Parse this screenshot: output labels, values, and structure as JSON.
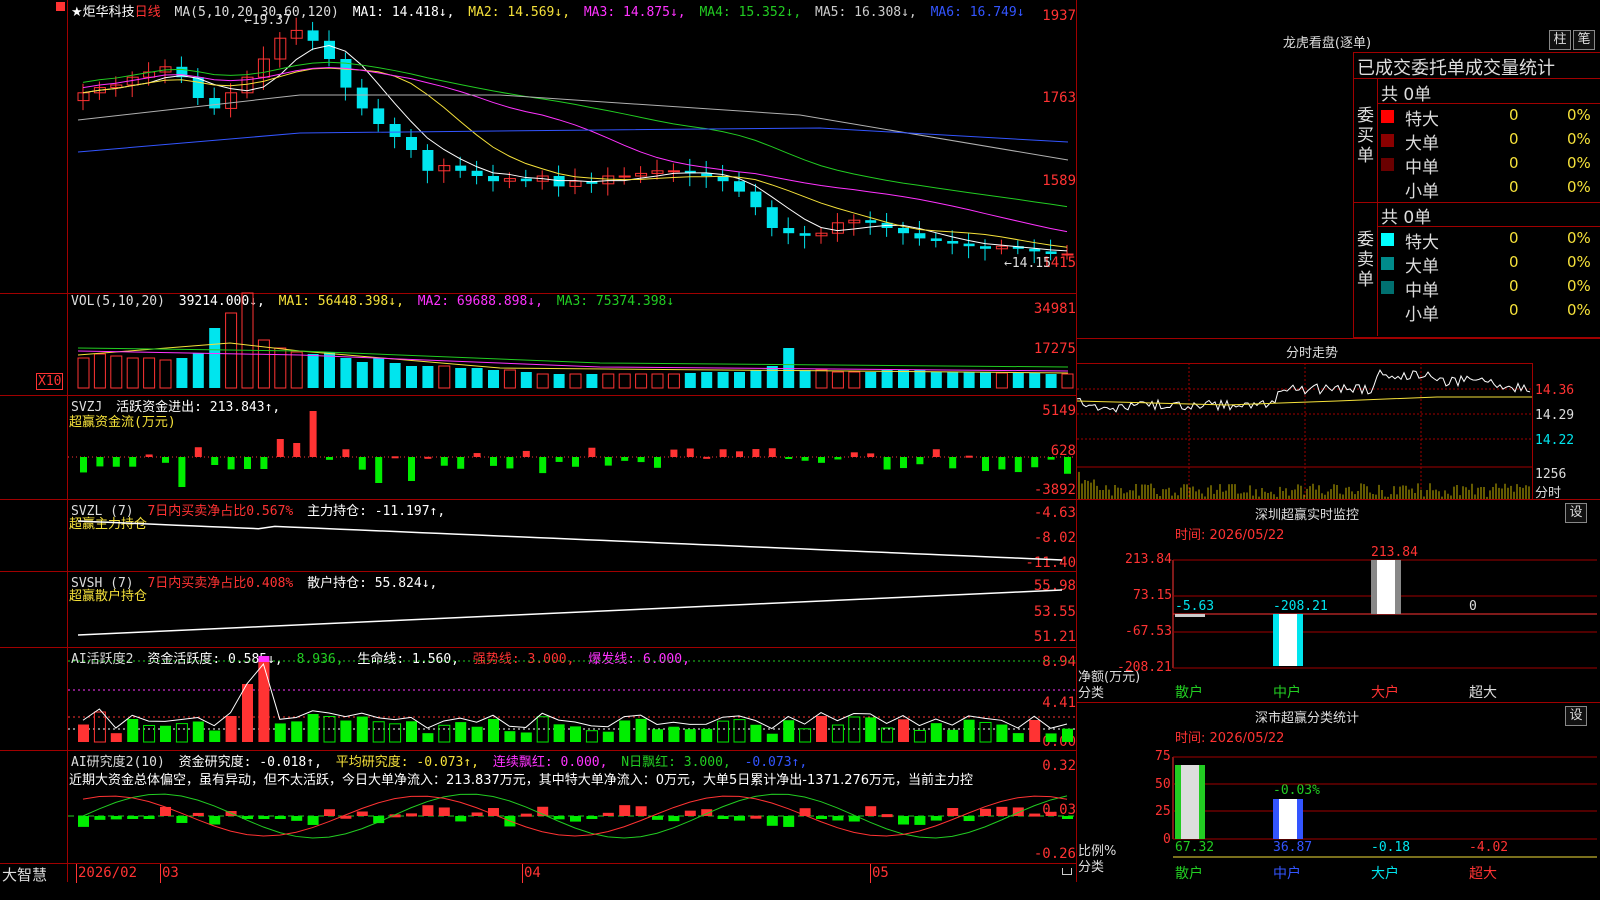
{
  "colors": {
    "up": "#ff3333",
    "down": "#00e5ee",
    "frame": "#a00000",
    "axis": "#ff3333",
    "ma1": "#ffffff",
    "ma2": "#f5e13a",
    "ma3": "#ff33ff",
    "ma4": "#22cc22",
    "ma5": "#b0b0b0",
    "ma6": "#3355ff"
  },
  "app": {
    "brand": "大智慧",
    "stock_name": "★炬华科技",
    "period": "日线"
  },
  "price": {
    "header": {
      "ma_def": "MA(5,10,20,30,60,120)",
      "ma1": "MA1: 14.418↓,",
      "ma2": "MA2: 14.569↓,",
      "ma3": "MA3: 14.875↓,",
      "ma4": "MA4: 15.352↓,",
      "ma5": "MA5: 16.308↓,",
      "ma6": "MA6: 16.749↓"
    },
    "yticks": [
      "1937",
      "1763",
      "1589",
      "1415"
    ],
    "high_label": "←19.37",
    "low_label": "←14.15"
  },
  "vol": {
    "header": {
      "def": "VOL(5,10,20)",
      "v": "39214.000↓,",
      "ma1": "MA1: 56448.398↓,",
      "ma2": "MA2: 69688.898↓,",
      "ma3": "MA3: 75374.398↓"
    },
    "yticks": [
      "34981",
      "17275"
    ],
    "unit": "X10"
  },
  "svzj": {
    "header": {
      "name": "SVZJ",
      "t1": "活跃资金进出: 213.843↑,",
      "sub": "超赢资金流(万元)"
    },
    "yticks": [
      "5149",
      "628",
      "-3892"
    ]
  },
  "svzl": {
    "header": {
      "name": "SVZL (7)",
      "t1": "7日内买卖净占比0.567%",
      "t2": "主力持仓: -11.197↑,",
      "sub": "超赢主力持仓"
    },
    "yticks": [
      "-4.63",
      "-8.02",
      "-11.40"
    ]
  },
  "svsh": {
    "header": {
      "name": "SVSH (7)",
      "t1": "7日内买卖净占比0.408%",
      "t2": "散户持仓: 55.824↓,",
      "sub": "超赢散户持仓"
    },
    "yticks": [
      "55.98",
      "53.55",
      "51.21"
    ]
  },
  "ai1": {
    "header": {
      "name": "AI活跃度2",
      "t1": "资金活跃度: 0.585↓,",
      "t2": "8.936,",
      "t3": "生命线: 1.560,",
      "t4": "强势线: 3.000,",
      "t5": "爆发线: 6.000,"
    },
    "yticks": [
      "8.94",
      "4.41",
      "0.00"
    ]
  },
  "ai2": {
    "header": {
      "name": "AI研究度2(10)",
      "t1": "资金研究度: -0.018↑,",
      "t2": "平均研究度: -0.073↑,",
      "t3": "连续飘红: 0.000,",
      "t4": "N日飘红: 3.000,",
      "t5": "-0.073↑,"
    },
    "note": "近期大资金总体偏空，虽有异动，但不太活跃，今日大单净流入：213.837万元，其中特大单净流入：0万元，大单5日累计净出-1371.276万元，当前主力控",
    "yticks": [
      "0.32",
      "0.03",
      "-0.26"
    ]
  },
  "dates": {
    "d1": "2026/02",
    "d2": "03",
    "d3": "04",
    "d4": "05"
  },
  "lhb": {
    "title": "龙虎看盘(逐单)",
    "btn1": "柱",
    "btn2": "笔",
    "section_title": "已成交委托单成交量统计",
    "buy": {
      "label": "委买单",
      "total": "共 0单",
      "rows": [
        {
          "name": "特大",
          "n": "0",
          "p": "0%",
          "c": "#ff0000"
        },
        {
          "name": "大单",
          "n": "0",
          "p": "0%",
          "c": "#8b0000"
        },
        {
          "name": "中单",
          "n": "0",
          "p": "0%",
          "c": "#6a0000"
        },
        {
          "name": "小单",
          "n": "0",
          "p": "0%",
          "c": ""
        }
      ]
    },
    "sell": {
      "label": "委卖单",
      "total": "共 0单",
      "rows": [
        {
          "name": "特大",
          "n": "0",
          "p": "0%",
          "c": "#00ffff"
        },
        {
          "name": "大单",
          "n": "0",
          "p": "0%",
          "c": "#008b8b"
        },
        {
          "name": "中单",
          "n": "0",
          "p": "0%",
          "c": "#007070"
        },
        {
          "name": "小单",
          "n": "0",
          "p": "0%",
          "c": ""
        }
      ]
    }
  },
  "intraday": {
    "title": "分时走势",
    "p1": "14.36",
    "p2": "14.29",
    "p3": "14.22",
    "v1": "1256",
    "v2": "分时"
  },
  "sz_monitor": {
    "title": "深圳超赢实时监控",
    "btn": "设",
    "time": "时间: 2026/05/22",
    "yticks": [
      "213.84",
      "73.15",
      "-67.53",
      "-208.21"
    ],
    "values": {
      "san": "-5.63",
      "zhong": "-208.21",
      "da": "213.84",
      "chao": "0"
    },
    "ylabel": "净额(万元)",
    "xlabel": "分类",
    "cats": [
      "散户",
      "中户",
      "大户",
      "超大"
    ]
  },
  "sz_class": {
    "title": "深市超赢分类统计",
    "btn": "设",
    "time": "时间: 2026/05/22",
    "yticks": [
      "75",
      "50",
      "25",
      "0"
    ],
    "top_label": "-0.03%",
    "values": {
      "san": "67.32",
      "zhong": "36.87",
      "da": "-0.18",
      "chao": "-4.02"
    },
    "ylabel": "比例%",
    "xlabel": "分类",
    "cats": [
      "散户",
      "中户",
      "大户",
      "超大"
    ]
  }
}
